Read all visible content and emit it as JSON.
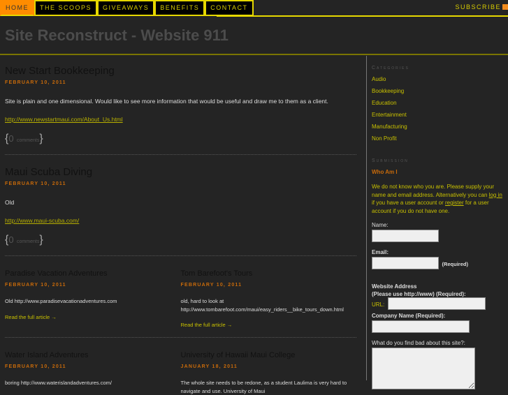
{
  "nav": {
    "items": [
      "HOME",
      "THE SCOOPS",
      "GIVEAWAYS",
      "BENEFITS",
      "CONTACT"
    ],
    "subscribe": "SUBSCRIBE"
  },
  "site_title": "Site Reconstruct - Website 911",
  "posts": [
    {
      "title": "New Start Bookkeeping",
      "date": "FEBRUARY 10, 2011",
      "body": "Site is plain and one dimensional. Would like to see more information that would be useful and draw me to them as a client.",
      "link": "http://www.newstartmaui.com/About_Us.html",
      "comments_count": "0",
      "comments_label": "comments"
    },
    {
      "title": "Maui Scuba Diving",
      "date": "FEBRUARY 10, 2011",
      "body": "Old",
      "link": "http://www.maui-scuba.com/",
      "comments_count": "0",
      "comments_label": "comments"
    }
  ],
  "grid_posts": [
    {
      "title": "Paradise Vacation Adventures",
      "date": "FEBRUARY 10, 2011",
      "body": "Old http://www.paradisevacationadventures.com",
      "read": "Read the full article →"
    },
    {
      "title": "Tom Barefoot's Tours",
      "date": "FEBRUARY 10, 2011",
      "body": "old, hard to look at http://www.tombarefoot.com/maui/easy_riders__bike_tours_down.html",
      "read": "Read the full article →"
    },
    {
      "title": "Water Island Adventures",
      "date": "FEBRUARY 10, 2011",
      "body": "boring http://www.waterislandadventures.com/"
    },
    {
      "title": "University of Hawaii Maui College",
      "date": "JANUARY 18, 2011",
      "body": "The whole site needs to be redone, as a student Laulima is very hard to navigate and use. University of Maui"
    }
  ],
  "sidebar": {
    "categories_heading": "Categories",
    "categories": [
      "Audio",
      "Bookkeeping",
      "Education",
      "Entertainment",
      "Manufacturing",
      "Non Profit"
    ],
    "submission_heading": "Submission",
    "who": "Who Am I",
    "intro_1": "We do not know who you are. Please supply your name and email address. Alternatively you can ",
    "login": "log in",
    "intro_2": " if you have a user account or ",
    "register": "register",
    "intro_3": " for a user account if you do not have one.",
    "name_label": "Name:",
    "email_label": "Email:",
    "required": "(Required)",
    "website_label": "Website Address",
    "website_hint": "(Please use http://www) (Required):",
    "url_label": "URL:",
    "company_label": "Company Name (Required):",
    "bad_label": "What do you find bad about this site?:"
  }
}
